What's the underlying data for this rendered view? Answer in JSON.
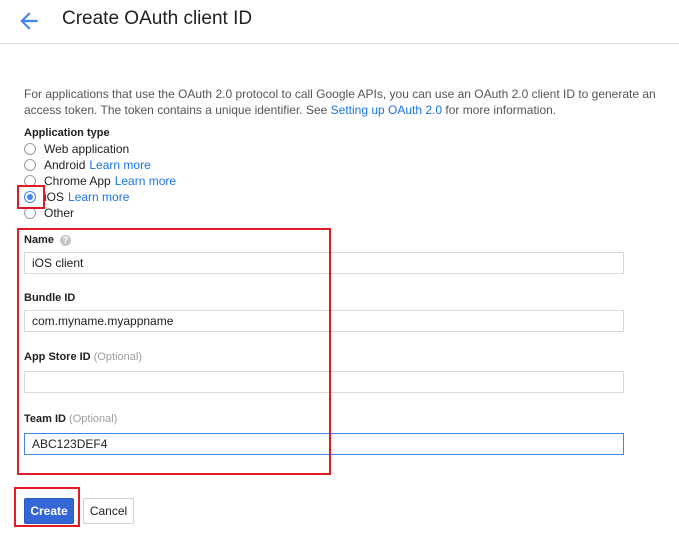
{
  "header": {
    "title": "Create OAuth client ID",
    "back_icon": "arrow-left-icon"
  },
  "intro": {
    "text_before": "For applications that use the OAuth 2.0 protocol to call Google APIs, you can use an OAuth 2.0 client ID to generate an access token. The token contains a unique identifier. See ",
    "link": "Setting up OAuth 2.0",
    "text_after": " for more information."
  },
  "application_type": {
    "label": "Application type",
    "options": [
      {
        "label": "Web application",
        "link": "",
        "checked": false
      },
      {
        "label": "Android",
        "link": "Learn more",
        "checked": false
      },
      {
        "label": "Chrome App",
        "link": "Learn more",
        "checked": false
      },
      {
        "label": "iOS",
        "link": "Learn more",
        "checked": true
      },
      {
        "label": "Other",
        "link": "",
        "checked": false
      }
    ]
  },
  "form": {
    "name_label": "Name",
    "name_value": "iOS client",
    "bundle_label": "Bundle ID",
    "bundle_value": "com.myname.myappname",
    "appstore_label": "App Store ID",
    "appstore_optional": "(Optional)",
    "appstore_value": "",
    "team_label": "Team ID",
    "team_optional": "(Optional)",
    "team_value": "ABC123DEF4"
  },
  "actions": {
    "create_label": "Create",
    "cancel_label": "Cancel"
  },
  "colors": {
    "accent": "#4285f4",
    "link": "#1a73e8",
    "primary_button": "#3367d6",
    "annotation": "#e01b24"
  }
}
